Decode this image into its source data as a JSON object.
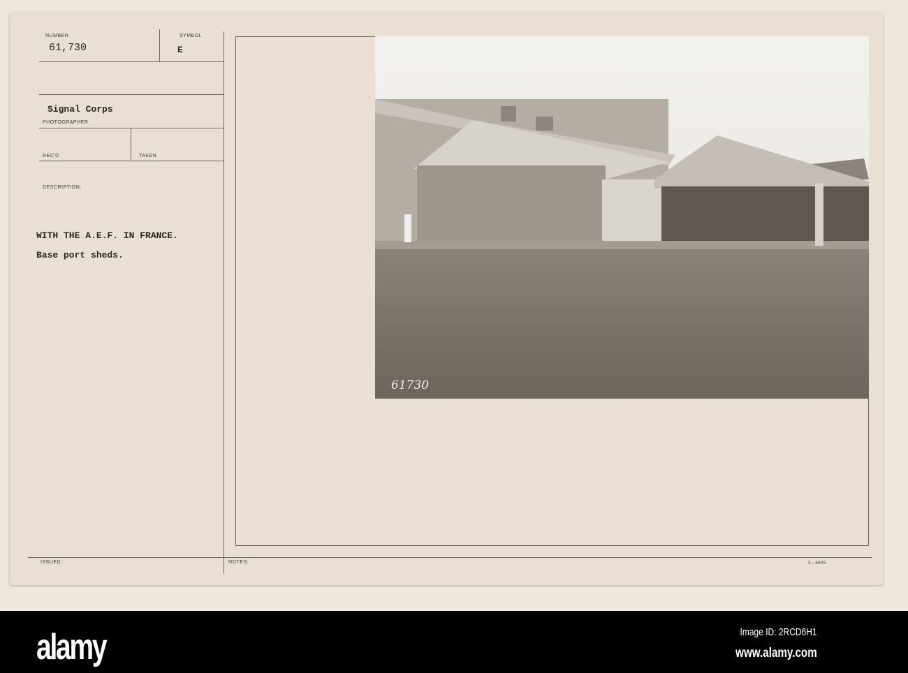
{
  "card": {
    "number_label": "NUMBER",
    "number": "61,730",
    "symbol_label": "SYMBOL",
    "symbol": "E",
    "photographer": "Signal Corps",
    "photographer_label": "PHOTOGRAPHER",
    "recd_label": "REC'D",
    "taken_label": "TAKEN",
    "description_label": "DESCRIPTION:",
    "description_line1": "WITH THE A.E.F. IN FRANCE.",
    "description_line2": "Base port sheds.",
    "issued_label": "ISSUED:",
    "notes_label": "NOTES:",
    "form_code": "3—5605"
  },
  "photo": {
    "negative_number": "61730"
  },
  "footer": {
    "logo": "alamy",
    "image_id": "Image ID: 2RCD6H1",
    "website": "www.alamy.com"
  }
}
